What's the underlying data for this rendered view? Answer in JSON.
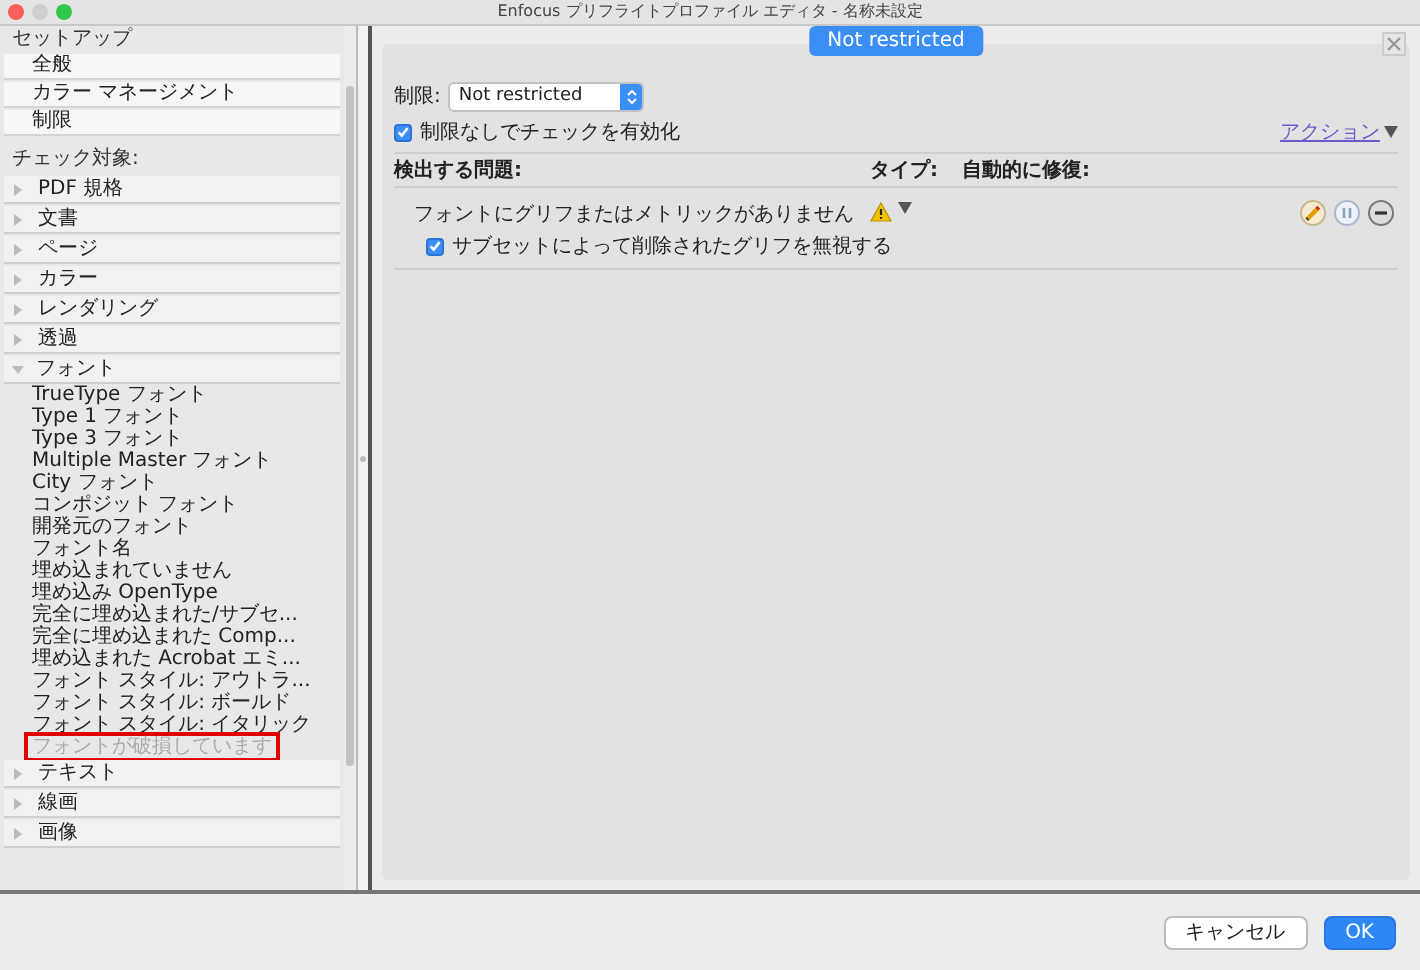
{
  "window": {
    "title": "Enfocus プリフライトプロファイル エディタ - 名称未設定"
  },
  "sidebar": {
    "setup_header": "セットアップ",
    "setup_items": [
      {
        "label": "全般",
        "selected": false
      },
      {
        "label": "カラー マネージメント",
        "selected": false
      },
      {
        "label": "制限",
        "selected": false
      }
    ],
    "check_label": "チェック対象:",
    "categories": [
      {
        "label": "PDF 規格",
        "expanded": false
      },
      {
        "label": "文書",
        "expanded": false
      },
      {
        "label": "ページ",
        "expanded": false
      },
      {
        "label": "カラー",
        "expanded": false
      },
      {
        "label": "レンダリング",
        "expanded": false
      },
      {
        "label": "透過",
        "expanded": false
      },
      {
        "label": "フォント",
        "expanded": true,
        "children": [
          {
            "label": "TrueType フォント",
            "disabled": false,
            "highlighted": false
          },
          {
            "label": "Type 1 フォント",
            "disabled": false,
            "highlighted": false
          },
          {
            "label": "Type 3 フォント",
            "disabled": false,
            "highlighted": false
          },
          {
            "label": "Multiple Master フォント",
            "disabled": false,
            "highlighted": false
          },
          {
            "label": "City フォント",
            "disabled": false,
            "highlighted": false
          },
          {
            "label": "コンポジット フォント",
            "disabled": false,
            "highlighted": false
          },
          {
            "label": "開発元のフォント",
            "disabled": false,
            "highlighted": false
          },
          {
            "label": "フォント名",
            "disabled": false,
            "highlighted": false
          },
          {
            "label": "埋め込まれていません",
            "disabled": false,
            "highlighted": false
          },
          {
            "label": "埋め込み OpenType",
            "disabled": false,
            "highlighted": false
          },
          {
            "label": "完全に埋め込まれた/サブセ...",
            "disabled": false,
            "highlighted": false
          },
          {
            "label": "完全に埋め込まれた Comp...",
            "disabled": false,
            "highlighted": false
          },
          {
            "label": "埋め込まれた Acrobat エミ...",
            "disabled": false,
            "highlighted": false
          },
          {
            "label": "フォント スタイル: アウトラ...",
            "disabled": false,
            "highlighted": false
          },
          {
            "label": "フォント スタイル: ボールド",
            "disabled": false,
            "highlighted": false
          },
          {
            "label": "フォント スタイル: イタリック",
            "disabled": false,
            "highlighted": false
          },
          {
            "label": "フォントが破損しています",
            "disabled": true,
            "highlighted": true
          }
        ]
      },
      {
        "label": "テキスト",
        "expanded": false
      },
      {
        "label": "線画",
        "expanded": false
      },
      {
        "label": "画像",
        "expanded": false
      }
    ]
  },
  "main": {
    "badge": "Not restricted",
    "restriction_label": "制限:",
    "restriction_value": "Not restricted",
    "enable_check": {
      "label": "制限なしでチェックを有効化",
      "checked": true
    },
    "action_link": "アクション",
    "columns": [
      "検出する問題:",
      "タイプ:",
      "自動的に修復:"
    ],
    "rows": [
      {
        "problem": "フォントにグリフまたはメトリックがありません",
        "option": {
          "label": "サブセットによって削除されたグリフを無視する",
          "checked": true
        },
        "kind": "warning"
      }
    ]
  },
  "buttons": [
    {
      "label": "キャンセル",
      "kind": "secondary"
    },
    {
      "label": "OK",
      "kind": "primary"
    }
  ]
}
